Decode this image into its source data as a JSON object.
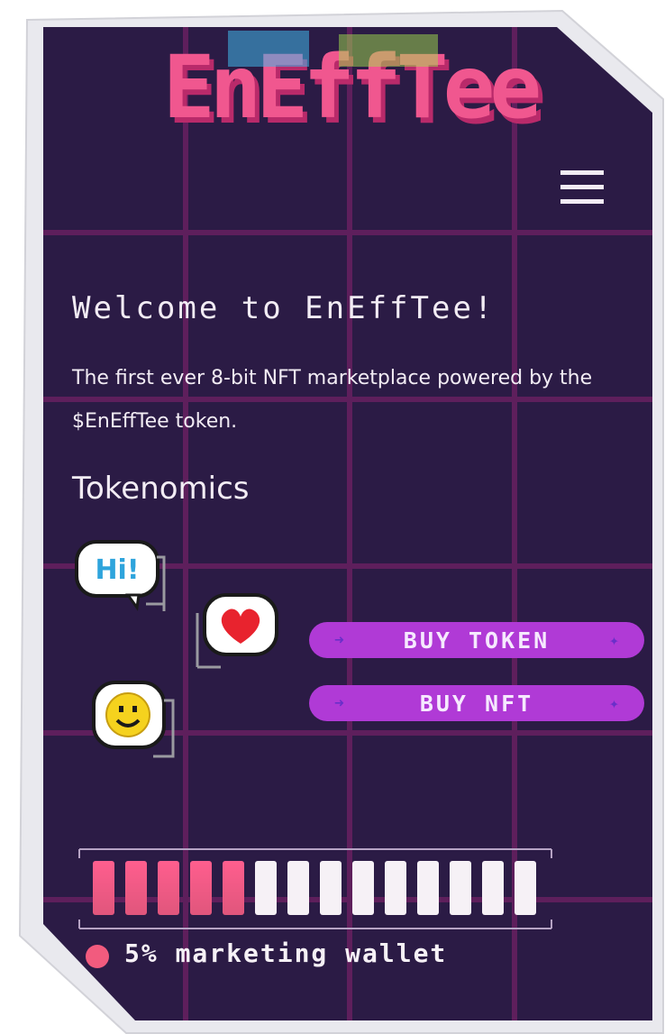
{
  "logo_text": "EnEffTee",
  "header": {
    "menu_icon": "hamburger-menu-icon"
  },
  "hero": {
    "title": "Welcome to EnEffTee!",
    "intro": "The first ever 8-bit NFT marketplace powered by the $EnEffTee token."
  },
  "tokenomics": {
    "heading": "Tokenomics",
    "stickers": [
      "Hi!",
      "heart-icon",
      "smiley-icon"
    ],
    "hi_text": "Hi!",
    "buttons": {
      "buy_token": "BUY TOKEN",
      "buy_nft": "BUY NFT"
    },
    "progress": {
      "filled_segments": 5,
      "total_segments": 14
    },
    "legend": {
      "label": "5% marketing wallet",
      "color": "#f25b7e"
    }
  },
  "colors": {
    "background": "#2b1b45",
    "grid": "#5e1f5c",
    "button": "#b03ad6",
    "text": "#f2ecf4",
    "accent_pink": "#ff5e8e"
  }
}
